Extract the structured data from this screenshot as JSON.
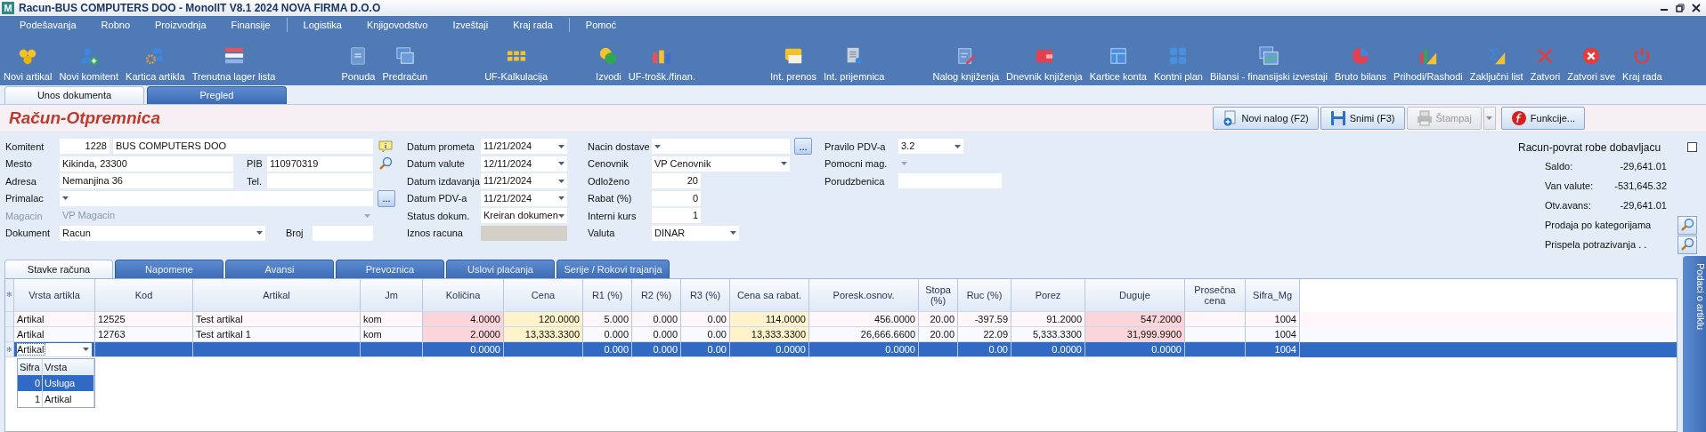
{
  "window": {
    "icon_letter": "M",
    "title": "Racun-BUS COMPUTERS DOO - MonolIT V8.1 2024 NOVA FIRMA D.O.O"
  },
  "menu": [
    [
      "Podešavanja",
      "Robno",
      "Proizvodnja",
      "Finansije"
    ],
    [
      "Logistika",
      "Knjigovodstvo",
      "Izveštaji",
      "Kraj rada"
    ],
    [
      "Pomoć"
    ]
  ],
  "toolbar": [
    "Novi artikal",
    "Novi komitent",
    "Kartica artikla",
    "Trenutna lager lista",
    "Ponuda",
    "Predračun",
    "UF-Kalkulacija",
    "Izvodi",
    "UF-trošk./finan.",
    "Int. prenos",
    "Int. prijemnica",
    "Nalog knjiženja",
    "Dnevnik knjiženja",
    "Kartice konta",
    "Kontni plan",
    "Bilansi - finansijski izvestaji",
    "Bruto bilans",
    "Prihodi/Rashodi",
    "Zaključni list",
    "Zatvori",
    "Zatvori sve",
    "Kraj rada"
  ],
  "tabs": [
    {
      "label": "Unos dokumenta",
      "selected": true
    },
    {
      "label": "Pregled",
      "selected": false
    }
  ],
  "document_title": "Račun-Otpremnica",
  "actions": [
    {
      "label": "Novi nalog (F2)",
      "disabled": false,
      "dropdown": false
    },
    {
      "label": "Snimi (F3)",
      "disabled": false,
      "dropdown": false
    },
    {
      "label": "Štampaj",
      "disabled": true,
      "dropdown": true
    },
    {
      "label": "Funkcije...",
      "disabled": false,
      "dropdown": false
    }
  ],
  "party": {
    "komitent": {
      "label": "Komitent",
      "code": "1228",
      "name": "BUS COMPUTERS DOO"
    },
    "mesto": {
      "label": "Mesto",
      "value": "Kikinda, 23300"
    },
    "pib": {
      "label": "PIB",
      "value": "110970319"
    },
    "adresa": {
      "label": "Adresa",
      "value": "Nemanjina 36"
    },
    "tel": {
      "label": "Tel."
    },
    "primalac": {
      "label": "Primalac",
      "button": "..."
    },
    "magacin": {
      "label": "Magacin",
      "value": "VP Magacin",
      "disabled": true
    },
    "dokument": {
      "label": "Dokument",
      "value": "Racun"
    },
    "broj": {
      "label": "Broj"
    }
  },
  "dates": [
    {
      "label": "Datum prometa",
      "kind": "dropdown",
      "value": "11/21/2024"
    },
    {
      "label": "Datum valute",
      "kind": "dropdown",
      "value": "12/11/2024"
    },
    {
      "label": "Datum izdavanja",
      "kind": "dropdown",
      "value": "11/21/2024"
    },
    {
      "label": "Datum PDV-a",
      "kind": "dropdown",
      "value": "11/21/2024"
    },
    {
      "label": "Status dokum.",
      "kind": "dropdown",
      "value": "Kreiran dokumen"
    },
    {
      "label": "Iznos racuna",
      "kind": "readonly"
    }
  ],
  "terms": [
    {
      "label": "Nacin dostave",
      "kind": "dropdown",
      "button": "..."
    },
    {
      "label": "Cenovnik",
      "kind": "dropdown",
      "value": "VP Cenovnik"
    },
    {
      "label": "Odloženo",
      "kind": "number",
      "value": "20"
    },
    {
      "label": "Rabat (%)",
      "kind": "number",
      "value": "0"
    },
    {
      "label": "Interni kurs",
      "kind": "number",
      "value": "1"
    },
    {
      "label": "Valuta",
      "kind": "small_dropdown",
      "value": "DINAR"
    }
  ],
  "extra": [
    {
      "label": "Pravilo PDV-a",
      "kind": "dropdown",
      "value": "3.2",
      "disabled": false
    },
    {
      "label": "Pomocni mag.",
      "kind": "dropdown",
      "disabled": true
    },
    {
      "label": "Porudzbenica",
      "kind": "text",
      "disabled": false
    }
  ],
  "return_to_supplier": {
    "label": "Racun-povrat robe dobavljacu",
    "checked": false
  },
  "balances": [
    {
      "label": "Saldo:",
      "value": "-29,641.01"
    },
    {
      "label": "Van valute:",
      "value": "-531,645.32"
    },
    {
      "label": "Otv.avans:",
      "value": "-29,641.01"
    }
  ],
  "reports": [
    "Prodaja po kategorijama",
    "Prispela potrazivanja . ."
  ],
  "item_tabs": [
    {
      "label": "Stavke računa",
      "selected": true
    },
    {
      "label": "Napomene",
      "selected": false
    },
    {
      "label": "Avansi",
      "selected": false
    },
    {
      "label": "Prevoznica",
      "selected": false
    },
    {
      "label": "Uslovi plaćanja",
      "selected": false
    },
    {
      "label": "Serije / Rokovi trajanja",
      "selected": false
    }
  ],
  "grid": {
    "marker": "✻",
    "columns": [
      {
        "label": "Vrsta artikla"
      },
      {
        "label": "Kod"
      },
      {
        "label": "Artikal"
      },
      {
        "label": "Jm"
      },
      {
        "label": "Količina",
        "color": "#fbd5d9"
      },
      {
        "label": "Cena",
        "color": "#fff3cc"
      },
      {
        "label": "R1 (%)"
      },
      {
        "label": "R2 (%)"
      },
      {
        "label": "R3 (%)"
      },
      {
        "label": "Cena sa rabat.",
        "color": "#fff3cc"
      },
      {
        "label": "Poresk.osnov."
      },
      {
        "label": "Stopa (%)"
      },
      {
        "label": "Ruc (%)"
      },
      {
        "label": "Porez"
      },
      {
        "label": "Duguje",
        "color": "#fbd5d9"
      },
      {
        "label": "Prosečna cena"
      },
      {
        "label": "Sifra_Mg"
      }
    ],
    "rows": [
      {
        "selected": false,
        "cells": [
          "Artikal",
          "12525",
          "Test artikal",
          "kom",
          "4.0000",
          "120.0000",
          "5.000",
          "0.000",
          "0.00",
          "114.0000",
          "456.0000",
          "20.00",
          "-397.59",
          "91.2000",
          "547.2000",
          null,
          "1004"
        ]
      },
      {
        "selected": false,
        "cells": [
          "Artikal",
          "12763",
          "Test artikal 1",
          "kom",
          "2.0000",
          "13,333.3300",
          "0.000",
          "0.000",
          "0.00",
          "13,333.3300",
          "26,666.6600",
          "20.00",
          "22.09",
          "5,333.3300",
          "31,999.9900",
          null,
          "1004"
        ]
      },
      {
        "selected": true,
        "marker": "✻",
        "cells": [
          "Artikal",
          null,
          null,
          null,
          "0.0000",
          null,
          "0.000",
          "0.000",
          "0.00",
          "0.0000",
          "0.0000",
          null,
          "0.00",
          "0.0000",
          "0.0000",
          null,
          "1004"
        ]
      }
    ]
  },
  "lookup": {
    "columns": [
      "Sifra",
      "Vrsta"
    ],
    "rows": [
      {
        "cells": [
          "0",
          "Usluga"
        ],
        "selected": true
      },
      {
        "cells": [
          "1",
          "Artikal"
        ],
        "selected": false
      }
    ]
  },
  "side_tab": "Podaci o artiklu"
}
